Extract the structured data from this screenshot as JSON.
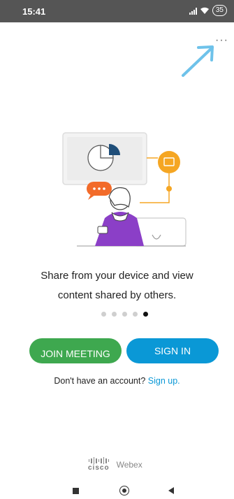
{
  "status_bar": {
    "time": "15:41",
    "battery": "35"
  },
  "tagline": {
    "line1": "Share from your device and view",
    "line2": "content shared by others."
  },
  "pager": {
    "count": 5,
    "active_index": 4
  },
  "buttons": {
    "join": "JOIN MEETING",
    "signin": "SIGN IN"
  },
  "signup": {
    "prompt": "Don't have an account?",
    "link": "Sign up."
  },
  "brand": {
    "cisco": "cisco",
    "webex": "Webex"
  },
  "colors": {
    "join_button": "#3ea84f",
    "signin_button": "#0a98d6",
    "link": "#0a98d6",
    "illustration_accent": "#f5a623",
    "illustration_chat": "#f26b2a",
    "illustration_purple": "#8b3fc7"
  }
}
